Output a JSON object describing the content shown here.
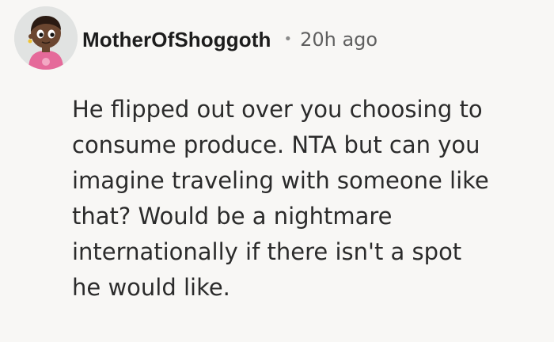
{
  "comment": {
    "username": "MotherOfShoggoth",
    "separator": "•",
    "timestamp": "20h ago",
    "body_lines": [
      "He flipped out over you choosing to",
      "consume produce. NTA but can you",
      "imagine traveling with someone like",
      "that? Would be a nightmare",
      "internationally if there isn't a spot",
      "he would like."
    ]
  },
  "colors": {
    "background": "#f8f7f5",
    "avatar_background": "#e1e3e2",
    "avatar_skin": "#6b4630",
    "avatar_shirt": "#e56a9a",
    "username_text": "#1c1c1c",
    "meta_text": "#5f5f5f"
  },
  "icons": {
    "avatar": "user-avatar-icon"
  }
}
